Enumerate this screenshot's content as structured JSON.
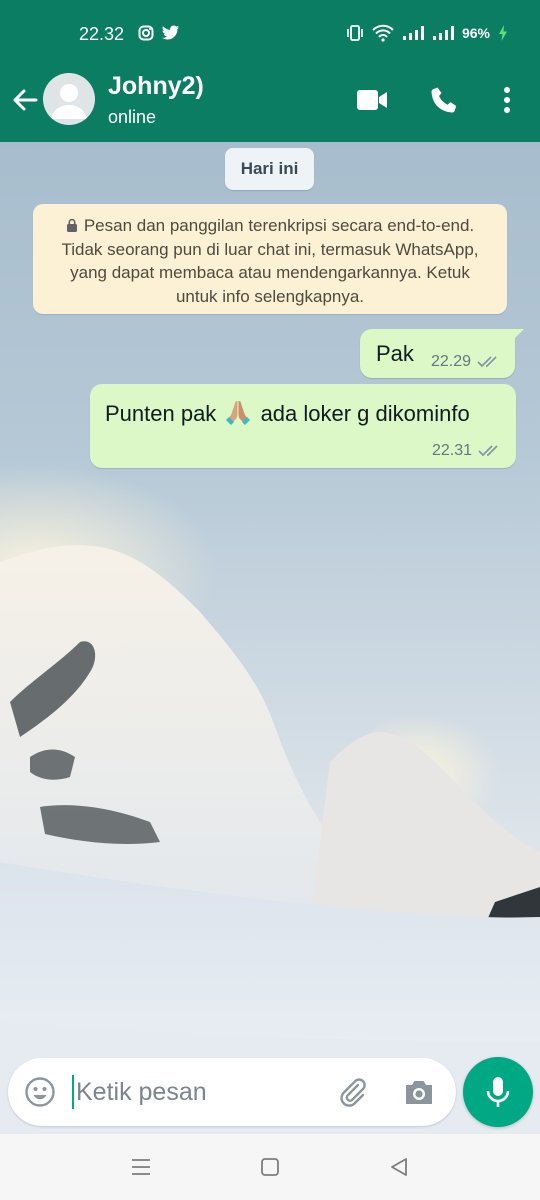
{
  "status_bar": {
    "time": "22.32",
    "battery_text": "96%",
    "left_icons": [
      "instagram-icon",
      "twitter-icon"
    ],
    "right_icons": [
      "vibrate-icon",
      "wifi-icon",
      "signal-icon",
      "signal-icon",
      "battery-charging-icon"
    ]
  },
  "header": {
    "contact_name": "Johny2)",
    "contact_status": "online",
    "icons": [
      "back-arrow-icon",
      "video-call-icon",
      "voice-call-icon",
      "more-vert-icon"
    ]
  },
  "chat": {
    "date_chip": "Hari ini",
    "encryption_notice": "Pesan dan panggilan terenkripsi secara end-to-end. Tidak seorang pun di luar chat ini, termasuk WhatsApp, yang dapat membaca atau mendengarkannya. Ketuk untuk info selengkapnya.",
    "messages": [
      {
        "direction": "outgoing",
        "text": "Pak",
        "time": "22.29",
        "status": "read-double-check"
      },
      {
        "direction": "outgoing",
        "text_before_emoji": "Punten pak",
        "emoji": "folded-hands",
        "text_after_emoji": "ada loker g dikominfo",
        "time": "22.31",
        "status": "read-double-check"
      }
    ]
  },
  "composer": {
    "placeholder": "Ketik pesan",
    "value": ""
  },
  "colors": {
    "header_green": "#0b7d62",
    "accent_green": "#00a884",
    "outgoing_bubble": "#dcf8c6",
    "notice_bg": "#fcf1d4"
  },
  "nav_bar": {
    "icons": [
      "recent-apps-icon",
      "home-icon",
      "back-icon"
    ]
  }
}
